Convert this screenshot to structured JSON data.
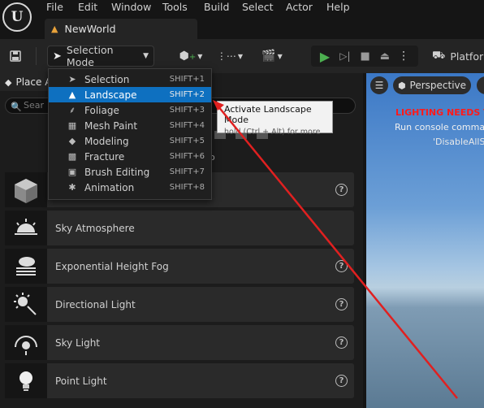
{
  "menubar": {
    "logo": "U",
    "items": [
      "File",
      "Edit",
      "Window",
      "Tools",
      "Build",
      "Select",
      "Actor",
      "Help"
    ]
  },
  "tab": {
    "title": "NewWorld"
  },
  "toolbar": {
    "mode_label": "Selection Mode",
    "platform_label": "Platfor"
  },
  "dropdown": {
    "items": [
      {
        "label": "Selection",
        "shortcut": "SHIFT+1",
        "icon": "selection-icon"
      },
      {
        "label": "Landscape",
        "shortcut": "SHIFT+2",
        "icon": "landscape-icon"
      },
      {
        "label": "Foliage",
        "shortcut": "SHIFT+3",
        "icon": "foliage-icon"
      },
      {
        "label": "Mesh Paint",
        "shortcut": "SHIFT+4",
        "icon": "mesh-paint-icon"
      },
      {
        "label": "Modeling",
        "shortcut": "SHIFT+5",
        "icon": "modeling-icon"
      },
      {
        "label": "Fracture",
        "shortcut": "SHIFT+6",
        "icon": "fracture-icon"
      },
      {
        "label": "Brush Editing",
        "shortcut": "SHIFT+7",
        "icon": "brush-editing-icon"
      },
      {
        "label": "Animation",
        "shortcut": "SHIFT+8",
        "icon": "animation-icon"
      }
    ],
    "active_index": 1
  },
  "tooltip": {
    "title": "Activate Landscape Mode",
    "hint": "hold (Ctrl + Alt) for more"
  },
  "left_panel": {
    "tab_label": "Place A",
    "search_placeholder": "Sear",
    "items": [
      {
        "label": "",
        "icon": "cube-icon"
      },
      {
        "label": "Sky Atmosphere",
        "icon": "sky-atmosphere-icon"
      },
      {
        "label": "Exponential Height Fog",
        "icon": "height-fog-icon"
      },
      {
        "label": "Directional Light",
        "icon": "directional-light-icon"
      },
      {
        "label": "Sky Light",
        "icon": "sky-light-icon"
      },
      {
        "label": "Point Light",
        "icon": "point-light-icon"
      }
    ]
  },
  "viewport": {
    "perspective_label": "Perspective",
    "warning": "LIGHTING NEEDS TO",
    "line1": "Run console comman",
    "line2": "'DisableAllS"
  },
  "colors": {
    "accent": "#0e70c0",
    "warning": "#ff1a1a",
    "annotation": "#e02020",
    "play": "#4caf50"
  }
}
